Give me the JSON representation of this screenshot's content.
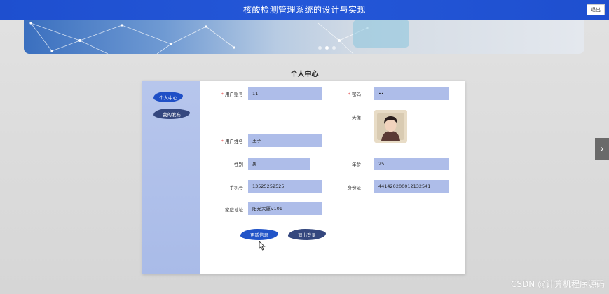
{
  "header": {
    "title": "核酸检测管理系统的设计与实现",
    "logout_label": "退出"
  },
  "banner": {
    "slides": 3,
    "active_slide": 1
  },
  "page": {
    "title": "个人中心"
  },
  "sidebar": {
    "items": [
      {
        "label": "个人中心"
      },
      {
        "label": "我的发布"
      }
    ]
  },
  "form": {
    "account": {
      "label": "用户账号",
      "value": "11",
      "required": true
    },
    "password": {
      "label": "密码",
      "value": "••",
      "required": true
    },
    "avatar": {
      "label": "头像"
    },
    "name": {
      "label": "用户姓名",
      "value": "王子",
      "required": true
    },
    "gender": {
      "label": "性别",
      "value": "男"
    },
    "age": {
      "label": "年龄",
      "value": "25"
    },
    "phone": {
      "label": "手机号",
      "value": "13525252525"
    },
    "id_card": {
      "label": "身份证",
      "value": "441420200012132541"
    },
    "address": {
      "label": "家庭地址",
      "value": "阳光大厦V101"
    }
  },
  "actions": {
    "update_label": "更新信息",
    "logout_label": "退出登录"
  },
  "watermark": "CSDN @计算机程序源码",
  "colors": {
    "topbar": "#2255d4",
    "field_bg": "#aebde9",
    "sidebar_bg": "#b0c1ea",
    "primary_button": "#2154c8",
    "secondary_button": "#34477e"
  }
}
